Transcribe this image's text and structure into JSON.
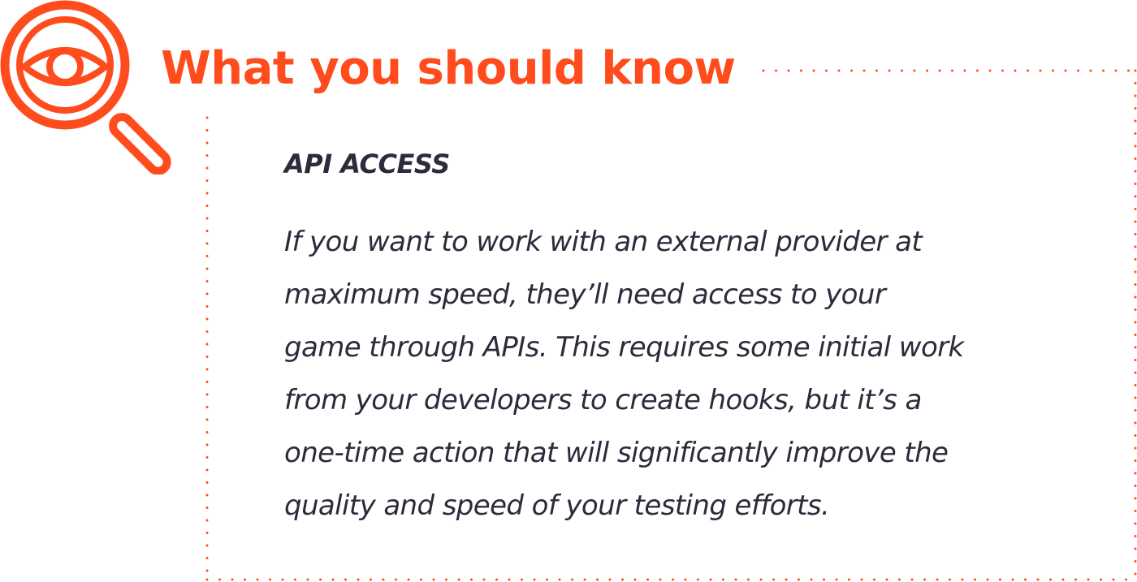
{
  "colors": {
    "accent": "#ff4c1d",
    "text": "#2b2b3b",
    "background": "#ffffff"
  },
  "icon": {
    "name": "magnifying-glass-eye-icon"
  },
  "title": "What you should know",
  "section": {
    "heading": "API ACCESS",
    "lines": [
      "If you want to work with an external provider at",
      "maximum speed, they’ll need access to your",
      "game through APIs. This requires some initial work",
      "from your developers to create hooks, but it’s a",
      "one-time action that will significantly improve the",
      "quality and speed of your testing efforts."
    ]
  }
}
